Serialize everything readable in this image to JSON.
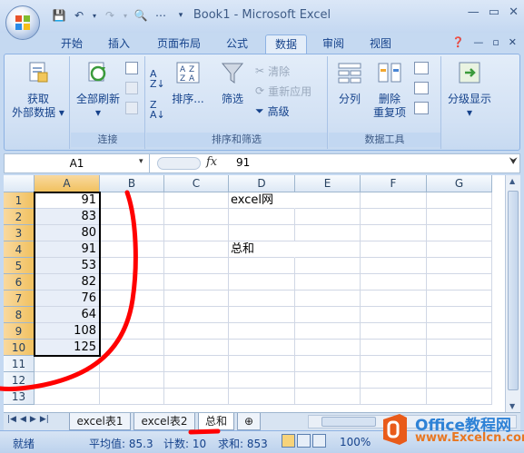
{
  "window": {
    "title": "Book1 - Microsoft Excel"
  },
  "tabs": [
    "开始",
    "插入",
    "页面布局",
    "公式",
    "数据",
    "审阅",
    "视图"
  ],
  "active_tab": "数据",
  "ribbon": {
    "get_external": "获取\n外部数据",
    "get_external_line1": "获取",
    "get_external_line2": "外部数据",
    "refresh_all": "全部刷新",
    "group_connections": "连接",
    "sort": "排序...",
    "filter": "筛选",
    "clear": "清除",
    "reapply": "重新应用",
    "advanced": "高级",
    "group_sort_filter": "排序和筛选",
    "text_to_columns": "分列",
    "remove_dup_line1": "删除",
    "remove_dup_line2": "重复项",
    "group_data_tools": "数据工具",
    "outline": "分级显示"
  },
  "formula_bar": {
    "name_box": "A1",
    "fx": "fx",
    "value": "91"
  },
  "columns": [
    "A",
    "B",
    "C",
    "D",
    "E",
    "F",
    "G"
  ],
  "rows": [
    "1",
    "2",
    "3",
    "4",
    "5",
    "6",
    "7",
    "8",
    "9",
    "10",
    "11",
    "12",
    "13"
  ],
  "column_a_values": [
    "91",
    "83",
    "80",
    "91",
    "53",
    "82",
    "76",
    "64",
    "108",
    "125"
  ],
  "d1_text": "excel网",
  "d4_text": "总和",
  "sheets": [
    "excel表1",
    "excel表2",
    "总和"
  ],
  "active_sheet": "总和",
  "status": {
    "ready": "就绪",
    "average": "平均值: 85.3",
    "count": "计数: 10",
    "sum": "求和: 853",
    "zoom": "100%"
  },
  "watermark": {
    "line1": "Office教程网",
    "line2": "www.Excelcn.com"
  },
  "colors": {
    "ribbon_bg": "#dbe7f7",
    "selection_header": "#f1c15f",
    "annotation": "#ff0000"
  }
}
